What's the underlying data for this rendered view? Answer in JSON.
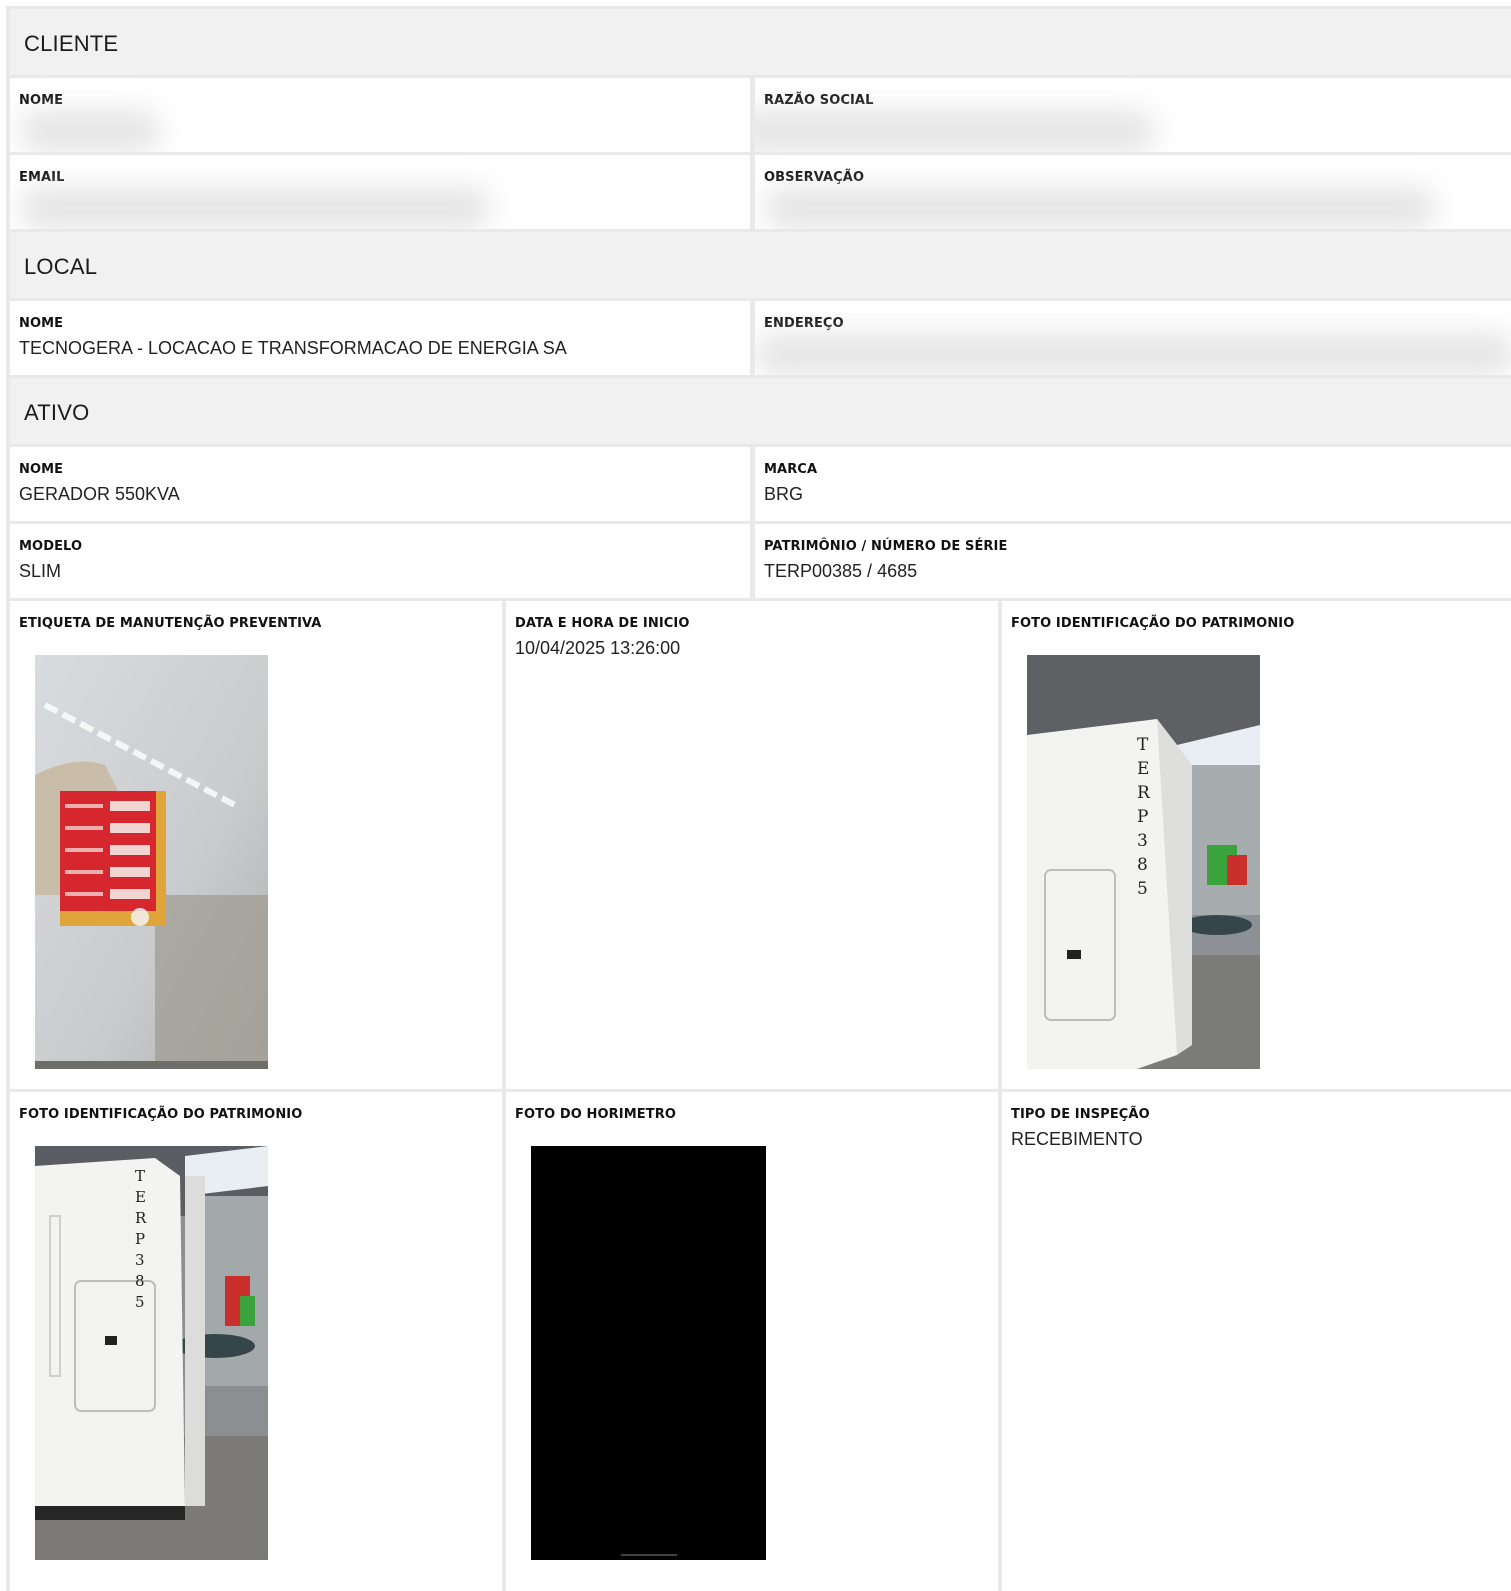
{
  "cliente": {
    "title": "CLIENTE",
    "nome_label": "NOME",
    "razao_label": "RAZÃO SOCIAL",
    "email_label": "EMAIL",
    "obs_label": "OBSERVAÇÃO"
  },
  "local": {
    "title": "LOCAL",
    "nome_label": "NOME",
    "nome_value": "TECNOGERA - LOCACAO E TRANSFORMACAO DE ENERGIA SA",
    "endereco_label": "ENDEREÇO"
  },
  "ativo": {
    "title": "ATIVO",
    "nome_label": "NOME",
    "nome_value": "GERADOR 550KVA",
    "marca_label": "MARCA",
    "marca_value": "BRG",
    "modelo_label": "MODELO",
    "modelo_value": "SLIM",
    "patrimonio_label": "PATRIMÔNIO / NÚMERO DE SÉRIE",
    "patrimonio_value": "TERP00385 / 4685"
  },
  "inspecao": {
    "etiqueta_label": "ETIQUETA DE MANUTENÇÃO PREVENTIVA",
    "data_label": "DATA E HORA DE INICIO",
    "data_value": "10/04/2025 13:26:00",
    "foto_patrimonio_label": "FOTO IDENTIFICAÇÃO DO PATRIMONIO",
    "foto_patrimonio2_label": "FOTO IDENTIFICAÇÃO DO PATRIMONIO",
    "foto_horimetro_label": "FOTO DO HORIMETRO",
    "tipo_label": "TIPO DE INSPEÇÃO",
    "tipo_value": "RECEBIMENTO"
  },
  "photos": {
    "etiqueta": "maintenance-tag-photo",
    "patrimonio_1": "generator-photo",
    "patrimonio_2": "generator-photo",
    "horimetro": "hour-meter-photo-black",
    "generator_stencil": "TERP385"
  }
}
